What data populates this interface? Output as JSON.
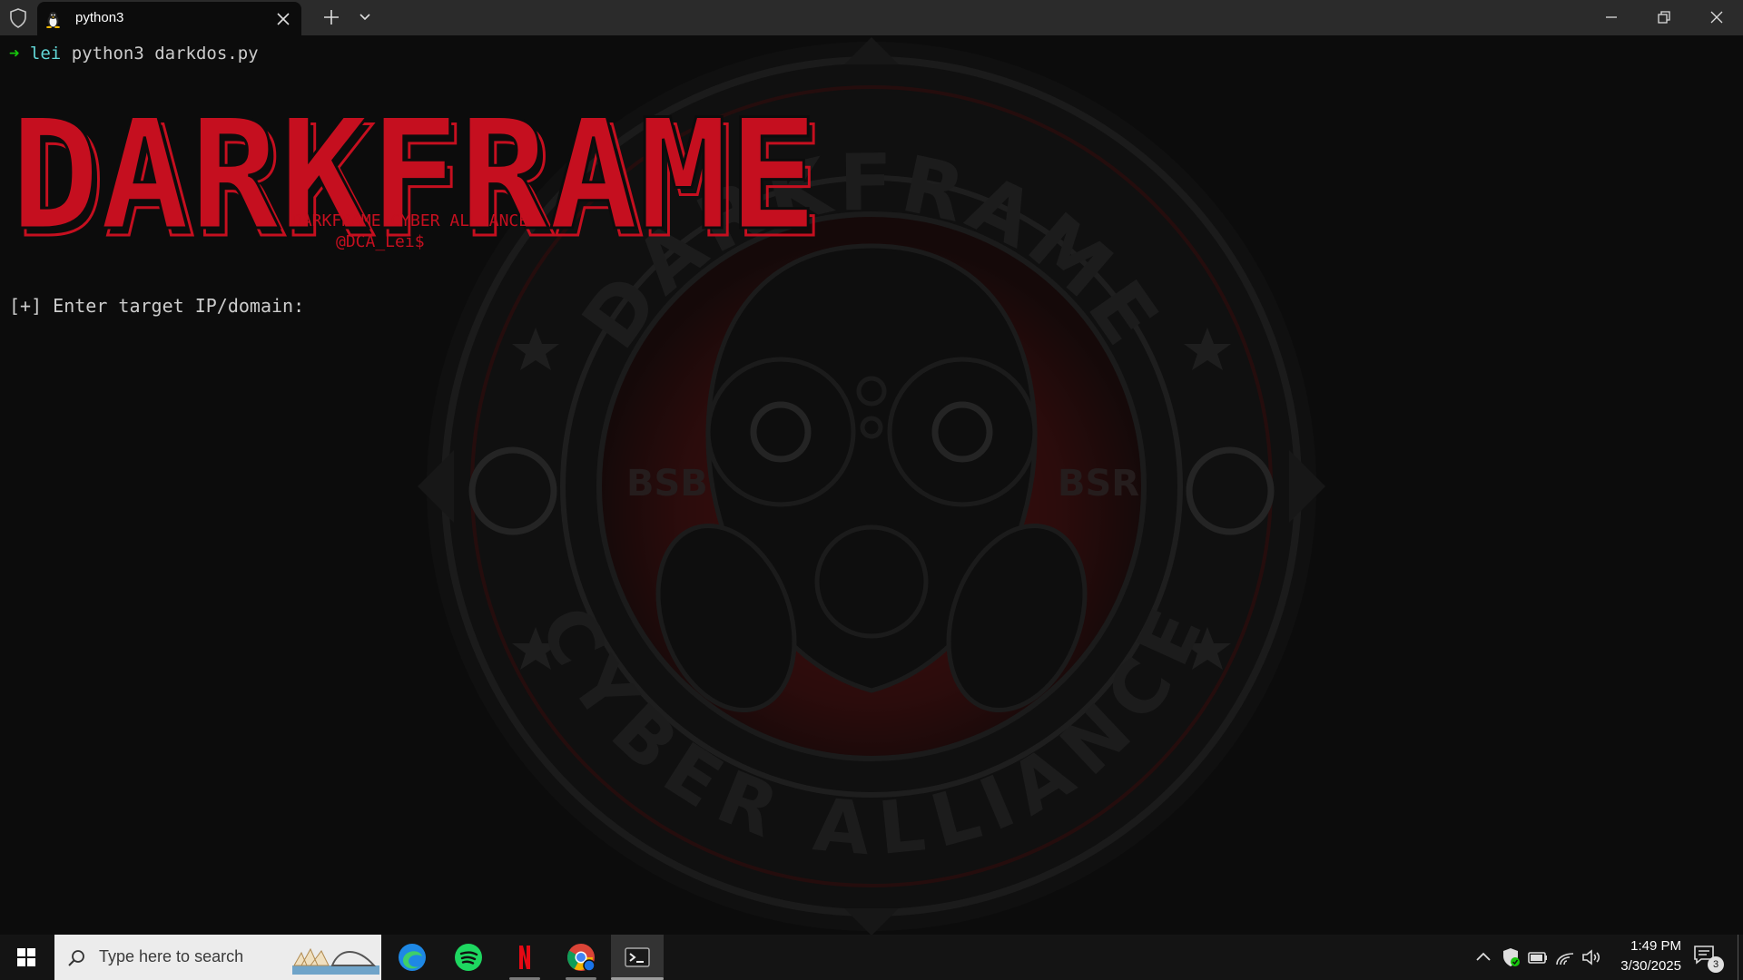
{
  "window": {
    "tab_title": "python3"
  },
  "terminal": {
    "prompt_arrow": "➜",
    "prompt_user": "lei",
    "command": "python3 darkdos.py",
    "logo_text": "DARKFRAME",
    "banner_line1": "DARKFRAME CYBER ALLIANCE",
    "banner_line2": "@DCA_Lei$",
    "input_prompt": "[+] Enter target IP/domain: ",
    "watermark": {
      "top_text": "DARKFRAME",
      "bottom_text": "CYBER ALLIANCE",
      "left_text": "BSB",
      "right_text": "BSR"
    }
  },
  "taskbar": {
    "search_placeholder": "Type here to search",
    "apps": [
      "edge",
      "spotify",
      "netflix",
      "chrome",
      "terminal"
    ],
    "time": "1:49 PM",
    "date": "3/30/2025",
    "notification_count": "3"
  },
  "colors": {
    "terminal_bg": "#0c0c0c",
    "titlebar_bg": "#2b2b2b",
    "logo_red": "#c50f1f",
    "prompt_green": "#16c60c",
    "user_cyan": "#61d6d6",
    "text_gray": "#cccccc"
  }
}
